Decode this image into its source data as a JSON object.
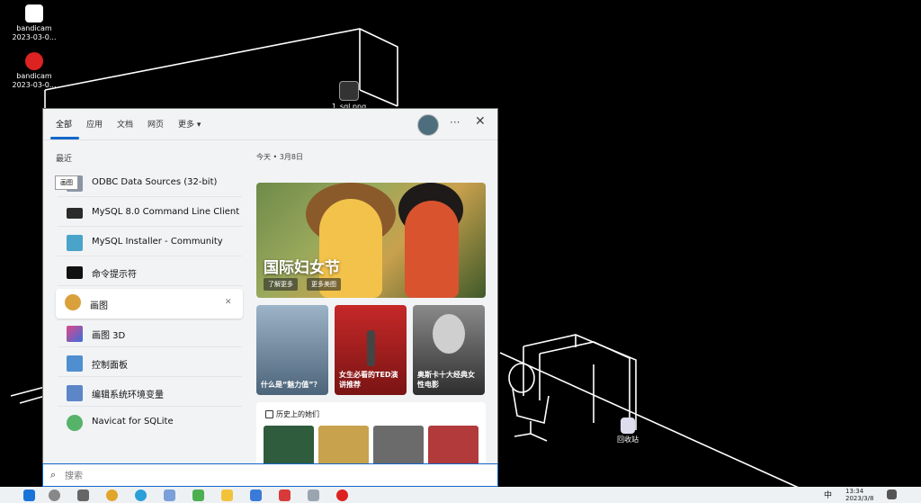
{
  "desktop": {
    "icons": [
      {
        "label": "bandicam",
        "sublabel": "2023-03-0...",
        "icon": "bandicam-video-icon"
      },
      {
        "label": "bandicam",
        "sublabel": "2023-03-0...",
        "icon": "bandicam-record-icon"
      }
    ],
    "file_label": "1_sql.png",
    "recycle_bin": "回收站"
  },
  "start": {
    "tabs": [
      "全部",
      "应用",
      "文档",
      "网页",
      "更多 ▾"
    ],
    "more_icon": "···",
    "close_icon": "✕",
    "recent_label": "最近",
    "apps": [
      {
        "label": "ODBC Data Sources (32-bit)",
        "color": "#8a96a6"
      },
      {
        "label": "MySQL 8.0 Command Line Client",
        "color": "#2b2b2b"
      },
      {
        "label": "MySQL Installer - Community",
        "color": "#4aa3c9"
      },
      {
        "label": "命令提示符",
        "color": "#111111"
      },
      {
        "label": "画图",
        "color": "#d9a13b"
      },
      {
        "label": "画图 3D",
        "color": "#3b6fd9"
      },
      {
        "label": "控制面板",
        "color": "#4f8fd1"
      },
      {
        "label": "编辑系统环境变量",
        "color": "#5c86c8"
      },
      {
        "label": "Navicat for SQLite",
        "color": "#58b36a"
      }
    ],
    "tooltip": "画图",
    "remove_icon": "✕",
    "date_label": "今天 • 3月8日",
    "hero": {
      "title": "国际妇女节",
      "btn1": "了解更多",
      "btn2": "更多美图"
    },
    "cards": [
      {
        "text": "什么是“魅力值”？",
        "bg": "#6d8aa3"
      },
      {
        "text": "女生必看的TED演讲推荐",
        "bg": "#b51f1f"
      },
      {
        "text": "奥斯卡十大经典女性电影",
        "bg": "#595959"
      }
    ],
    "history": {
      "title": "历史上的她们"
    },
    "search": {
      "placeholder": "搜索"
    }
  },
  "taskbar": {
    "lang": "中",
    "time": "13:34",
    "date": "2023/3/8"
  },
  "colors": {
    "accent": "#1167c9"
  }
}
